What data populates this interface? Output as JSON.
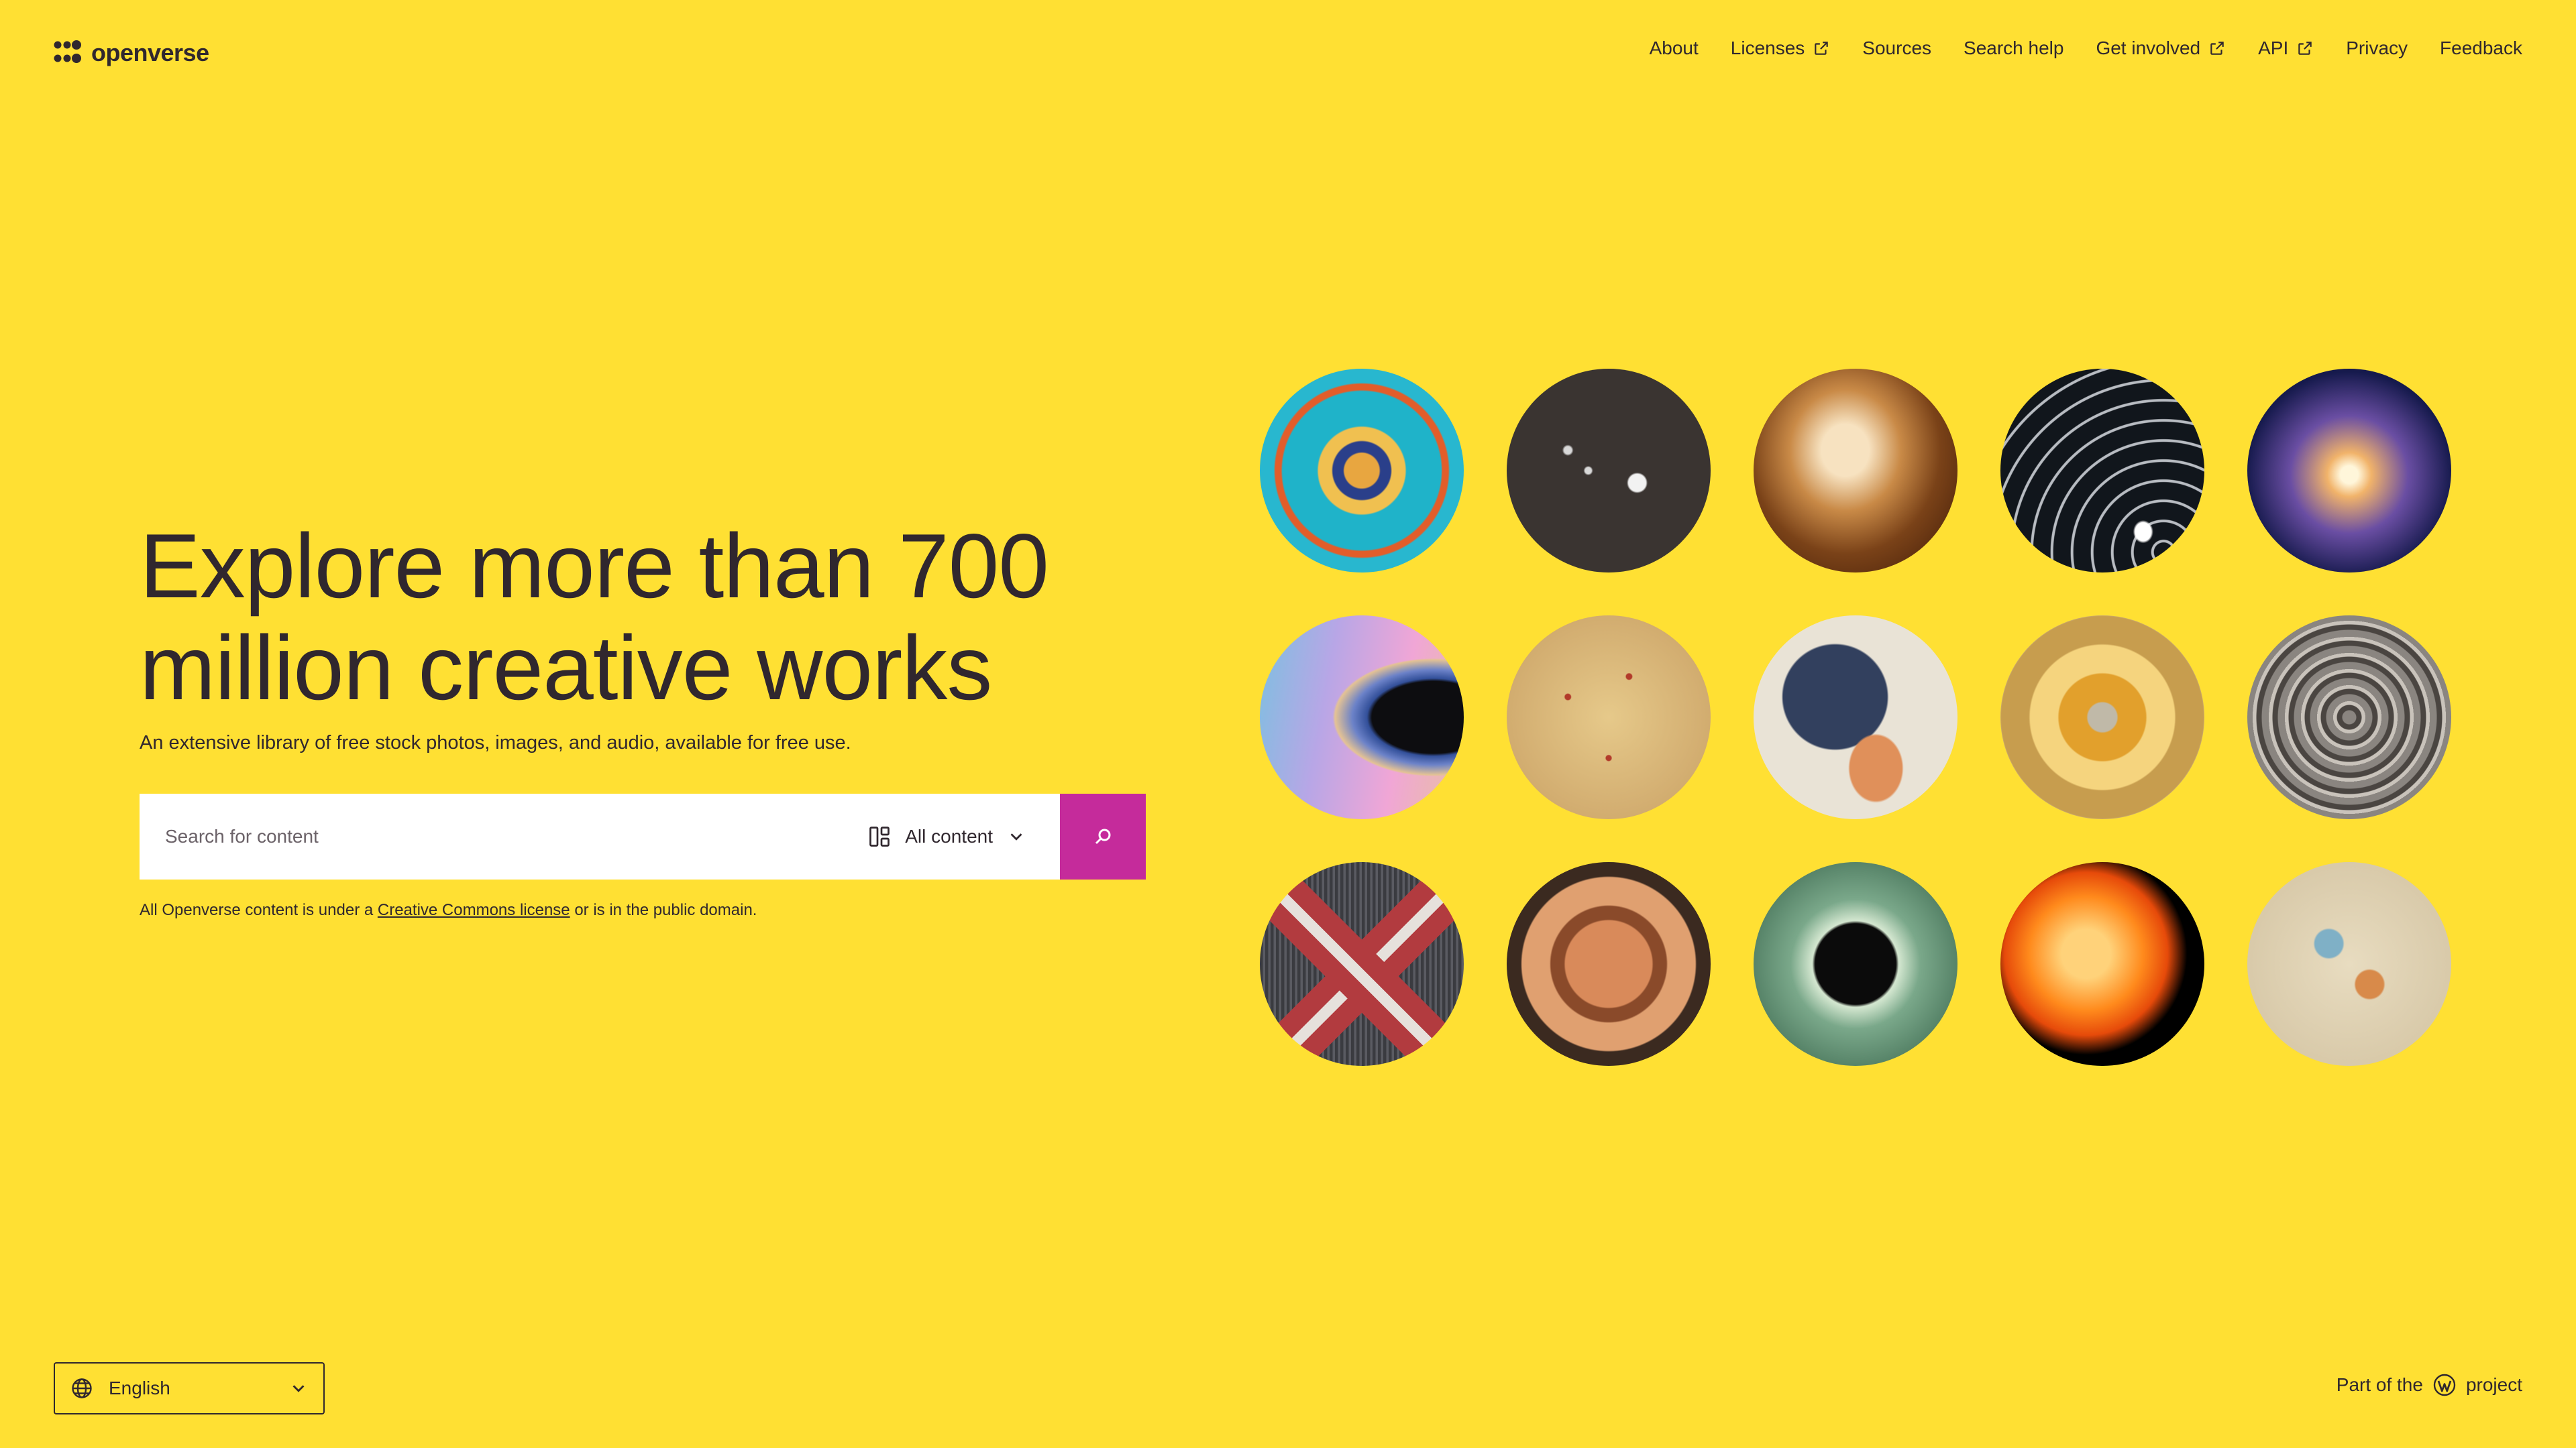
{
  "header": {
    "logo_text": "openverse",
    "nav": [
      {
        "label": "About",
        "external": false
      },
      {
        "label": "Licenses",
        "external": true
      },
      {
        "label": "Sources",
        "external": false
      },
      {
        "label": "Search help",
        "external": false
      },
      {
        "label": "Get involved",
        "external": true
      },
      {
        "label": "API",
        "external": true
      },
      {
        "label": "Privacy",
        "external": false
      },
      {
        "label": "Feedback",
        "external": false
      }
    ]
  },
  "hero": {
    "title": "Explore more than 700 million creative works",
    "subtitle": "An extensive library of free stock photos, images, and audio, available for free use."
  },
  "search": {
    "placeholder": "Search for content",
    "content_type": "All content",
    "search_icon": "search-icon"
  },
  "license_note": {
    "prefix": "All Openverse content is under a ",
    "link": "Creative Commons license",
    "suffix": " or is in the public domain."
  },
  "footer": {
    "language": "English",
    "part_of_prefix": "Part of the",
    "part_of_suffix": "project",
    "wp_icon": "wordpress-icon"
  },
  "colors": {
    "background": "#FFE033",
    "accent": "#C52B9B",
    "text": "#30272E"
  }
}
